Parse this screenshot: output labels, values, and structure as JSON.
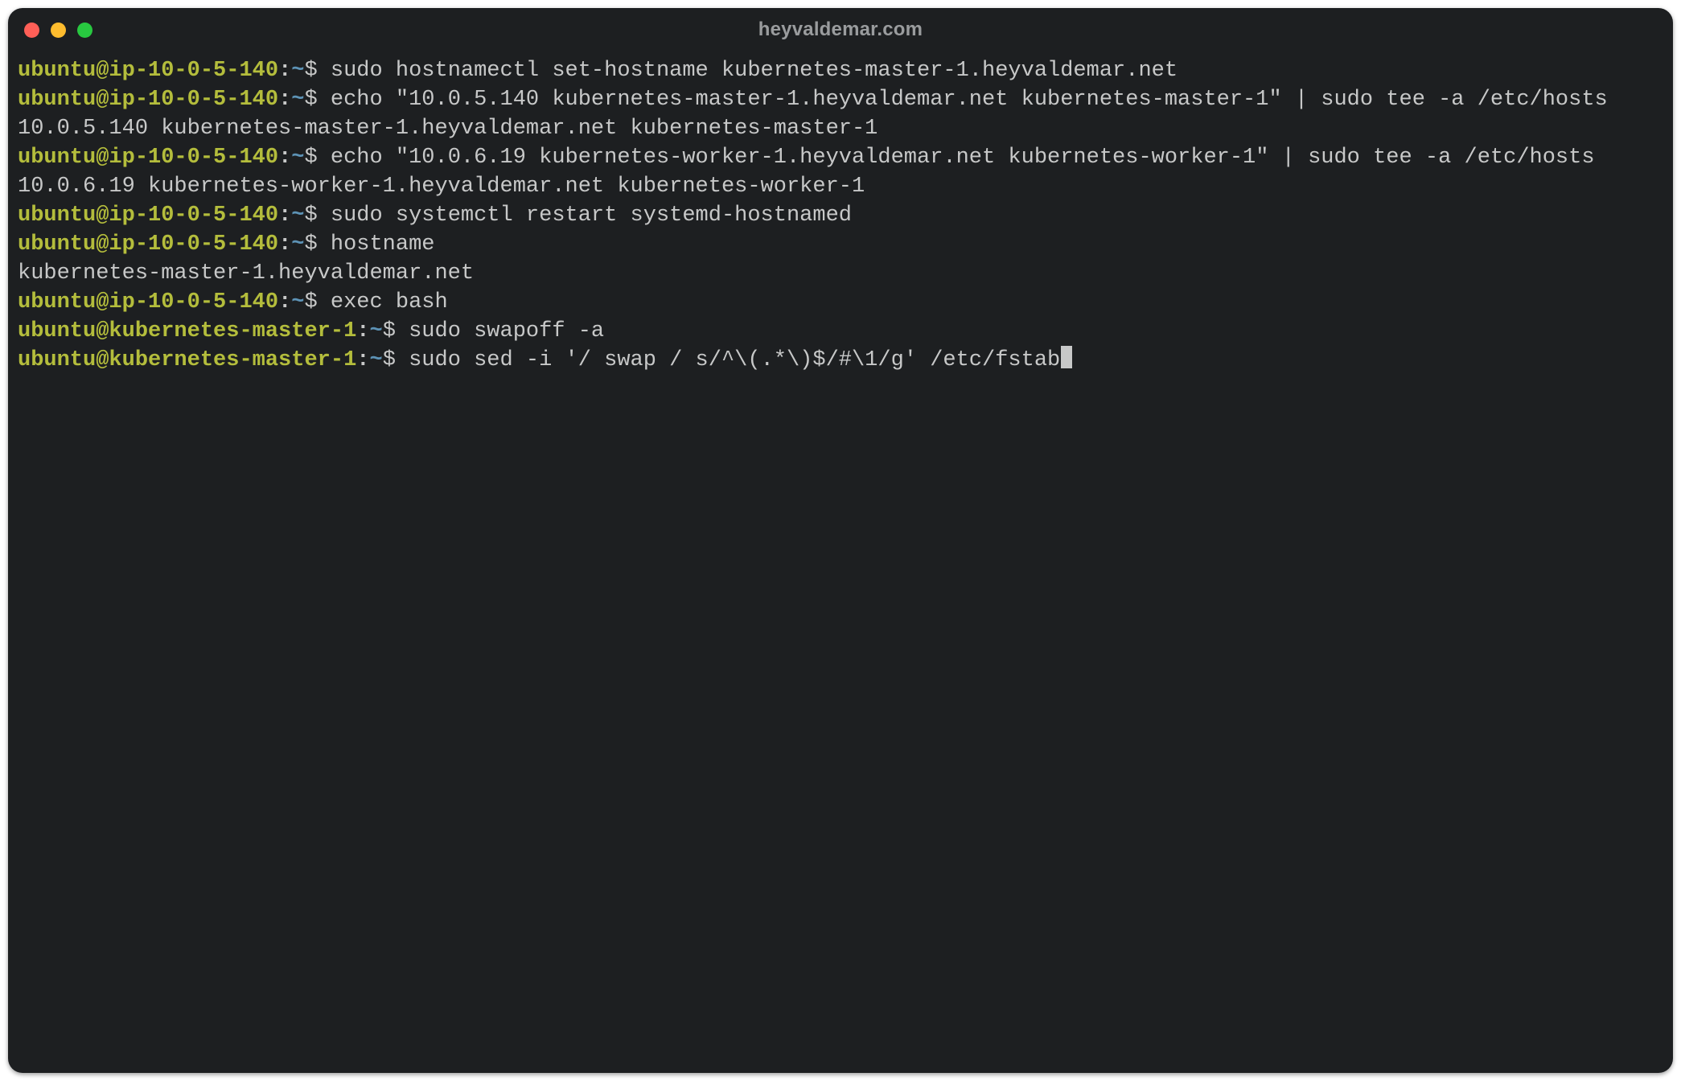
{
  "window": {
    "title": "heyvaldemar.com",
    "traffic_lights": {
      "close": "red",
      "minimize": "yellow",
      "zoom": "green"
    }
  },
  "colors": {
    "bg": "#1d1f21",
    "fg": "#c7c8c8",
    "user_host": "#b4bd3c",
    "path": "#5d93b6",
    "title": "#9a9c9e"
  },
  "prompts": {
    "p1": {
      "user_host": "ubuntu@ip-10-0-5-140",
      "sep": ":",
      "path": "~",
      "symbol": "$"
    },
    "p2": {
      "user_host": "ubuntu@kubernetes-master-1",
      "sep": ":",
      "path": "~",
      "symbol": "$"
    }
  },
  "session": {
    "lines": [
      {
        "type": "cmd",
        "prompt": "p1",
        "command": "sudo hostnamectl set-hostname kubernetes-master-1.heyvaldemar.net"
      },
      {
        "type": "cmd",
        "prompt": "p1",
        "command": "echo \"10.0.5.140 kubernetes-master-1.heyvaldemar.net kubernetes-master-1\" | sudo tee -a /etc/hosts"
      },
      {
        "type": "out",
        "text": "10.0.5.140 kubernetes-master-1.heyvaldemar.net kubernetes-master-1"
      },
      {
        "type": "cmd",
        "prompt": "p1",
        "command": "echo \"10.0.6.19 kubernetes-worker-1.heyvaldemar.net kubernetes-worker-1\" | sudo tee -a /etc/hosts"
      },
      {
        "type": "out",
        "text": "10.0.6.19 kubernetes-worker-1.heyvaldemar.net kubernetes-worker-1"
      },
      {
        "type": "cmd",
        "prompt": "p1",
        "command": "sudo systemctl restart systemd-hostnamed"
      },
      {
        "type": "cmd",
        "prompt": "p1",
        "command": "hostname"
      },
      {
        "type": "out",
        "text": "kubernetes-master-1.heyvaldemar.net"
      },
      {
        "type": "cmd",
        "prompt": "p1",
        "command": "exec bash"
      },
      {
        "type": "cmd",
        "prompt": "p2",
        "command": "sudo swapoff -a"
      },
      {
        "type": "cmd",
        "prompt": "p2",
        "command": "sudo sed -i '/ swap / s/^\\(.*\\)$/#\\1/g' /etc/fstab",
        "cursor": true
      }
    ]
  }
}
